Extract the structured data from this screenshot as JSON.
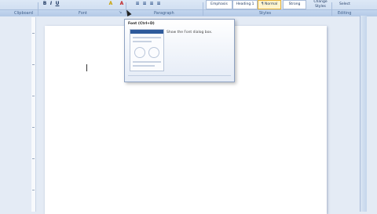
{
  "ribbon": {
    "group_labels": [
      "Clipboard",
      "Font",
      "Paragraph",
      "Styles",
      "Editing"
    ],
    "format_buttons": [
      "B",
      "I",
      "U",
      "A",
      "A"
    ],
    "styles": [
      "Emphasis",
      "Heading 1",
      "¶ Normal",
      "Strong"
    ],
    "change_styles": "Change Styles",
    "select": "Select"
  },
  "tooltip": {
    "title": "Font (Ctrl+D)",
    "description": "Show the Font dialog box."
  },
  "colors": {
    "accent": "#2e5a9b",
    "ribbon_bg": "#c9d9ee",
    "active_style": "#e6b23a"
  }
}
